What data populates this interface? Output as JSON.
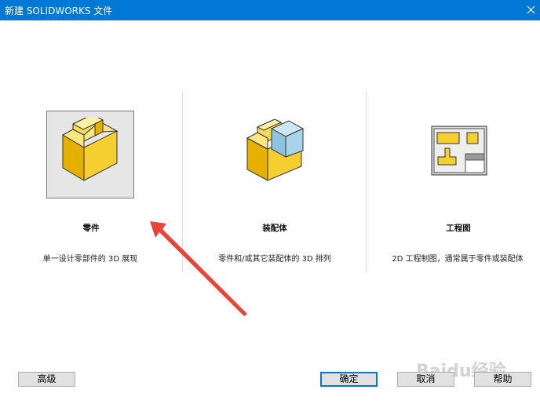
{
  "window": {
    "title": "新建 SOLIDWORKS 文件"
  },
  "options": [
    {
      "title": "零件",
      "description": "单一设计零部件的 3D 展现",
      "selected": true,
      "icon": "part-icon"
    },
    {
      "title": "装配体",
      "description": "零件和/或其它装配体的 3D 排列",
      "selected": false,
      "icon": "assembly-icon"
    },
    {
      "title": "工程图",
      "description": "2D 工程制图，通常属于零件或装配体",
      "selected": false,
      "icon": "drawing-icon"
    }
  ],
  "buttons": {
    "advanced": "高级",
    "ok": "确定",
    "cancel": "取消",
    "help": "帮助"
  },
  "watermark": "Baidu经验",
  "colors": {
    "titlebar": "#0078d7",
    "part_yellow": "#f5d547",
    "assembly_blue": "#8ec3df",
    "arrow": "#e8443a"
  }
}
